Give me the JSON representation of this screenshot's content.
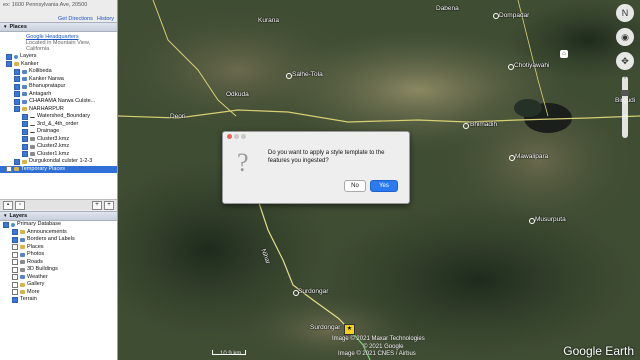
{
  "sidebar": {
    "address": "ex: 1600 Pennsylvania Ave, 20500",
    "links": [
      "Get Directions",
      "History"
    ],
    "places_header": "Places",
    "search_result_title": "Google Headquarters",
    "search_result_sub1": "Located in Mountain View,",
    "search_result_sub2": "California",
    "places_items": [
      "Layers",
      "Kanker",
      "Kollibeda",
      "Kanker Narwa",
      "Bhanupratapur",
      "Antagarh",
      "CHARAMA Narwa Culste...",
      "NARHARPUR",
      "Watershed_Boundary",
      "3rd_&_4th_order",
      "Drainage",
      "Cluster3.kmz",
      "Cluster2.kmz",
      "Cluster1.kmz",
      "Durgukondal culster 1-2-3",
      "Temporary Places"
    ],
    "layers_header": "Layers",
    "layers_items": [
      "Primary Database",
      "Announcements",
      "Borders and Labels",
      "Places",
      "Photos",
      "Roads",
      "3D Buildings",
      "Weather",
      "Gallery",
      "More",
      "Terrain"
    ]
  },
  "map": {
    "labels": [
      "Dabena",
      "Dompadar",
      "Kurana",
      "Chotiyawahi",
      "Salhe-Tola",
      "Odkuda",
      "Deori",
      "Bhimadih",
      "Mawalipara",
      "Musurputa",
      "Surdongar",
      "Surdongar",
      "Birgudi",
      "Nihar"
    ],
    "attribution1": "Image © 2021 Maxar Technologies",
    "attribution2": "© 2021 Google",
    "attribution3": "Image © 2021 CNES / Airbus",
    "scale": "10.9 km",
    "logo": "Google Earth"
  },
  "dialog": {
    "message": "Do you want to apply a style template to the features you ingested?",
    "no_label": "No",
    "yes_label": "Yes"
  },
  "colors": {
    "accent": "#2f6fd6",
    "yes_button": "#2a7bf0",
    "path": "#d7cf73"
  }
}
